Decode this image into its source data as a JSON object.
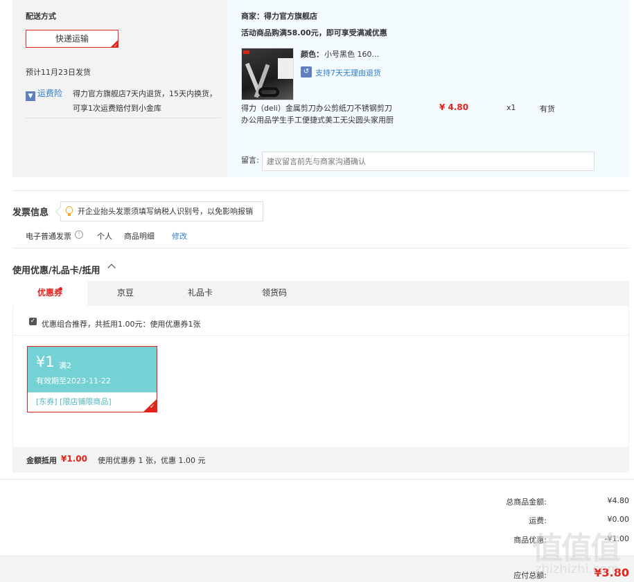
{
  "delivery": {
    "title": "配送方式",
    "method": "快递运输",
    "ship_date": "预计11月23日发货",
    "insurance_label": "运费险",
    "insurance_icon": "insurance-icon",
    "insurance_desc_1": "得力官方旗舰店7天内退货，15天内换货，",
    "insurance_desc_2": "可享1次运费赔付到小金库"
  },
  "seller": {
    "name": "商家：得力官方旗舰店",
    "promo": "活动商品购满58.00元，即可享受满减优惠",
    "color_label": "颜色：",
    "color_value": "小号黑色 160...",
    "return_policy": "支持7天无理由退货",
    "product_name_1": "得力（deli）金属剪刀办公剪纸刀不锈钢剪刀",
    "product_name_2": "办公用品学生手工便捷式美工无尖圆头家用厨",
    "price": "¥ 4.80",
    "quantity": "x1",
    "stock": "有货",
    "comment_label": "留言:",
    "comment_placeholder": "建议留言前先与商家沟通确认"
  },
  "invoice": {
    "title": "发票信息",
    "tip": "开企业抬头发票须填写纳税人识别号，以免影响报销",
    "type": "电子普通发票",
    "holder": "个人",
    "content": "商品明细",
    "edit": "修改"
  },
  "coupon": {
    "title": "使用优惠/礼品卡/抵用",
    "tabs": [
      "优惠券",
      "京豆",
      "礼品卡",
      "领货码"
    ],
    "recommend": "优惠组合推荐，共抵用1.00元：使用优惠券1张",
    "card": {
      "value": "¥1",
      "threshold": "满2",
      "expiry": "有效期至2023-11-22",
      "tags": "[东券] [限店铺限商品]"
    },
    "deduct_label": "金额抵用",
    "deduct_amount": "¥1.00",
    "deduct_desc": "使用优惠券 1 张，优惠 1.00 元"
  },
  "summary": {
    "goods_label": "总商品金额:",
    "goods_value": "¥4.80",
    "freight_label": "运费:",
    "freight_value": "¥0.00",
    "discount_label": "商品优惠:",
    "discount_value": "-¥1.00",
    "payable_label": "应付总额:",
    "payable_value": "¥3.80"
  },
  "watermark": {
    "text": "值值值",
    "sub": "zhizhizhi.com"
  },
  "colors": {
    "accent": "#e2231a",
    "link": "#2f7dcd",
    "coupon": "#75d2d4"
  }
}
